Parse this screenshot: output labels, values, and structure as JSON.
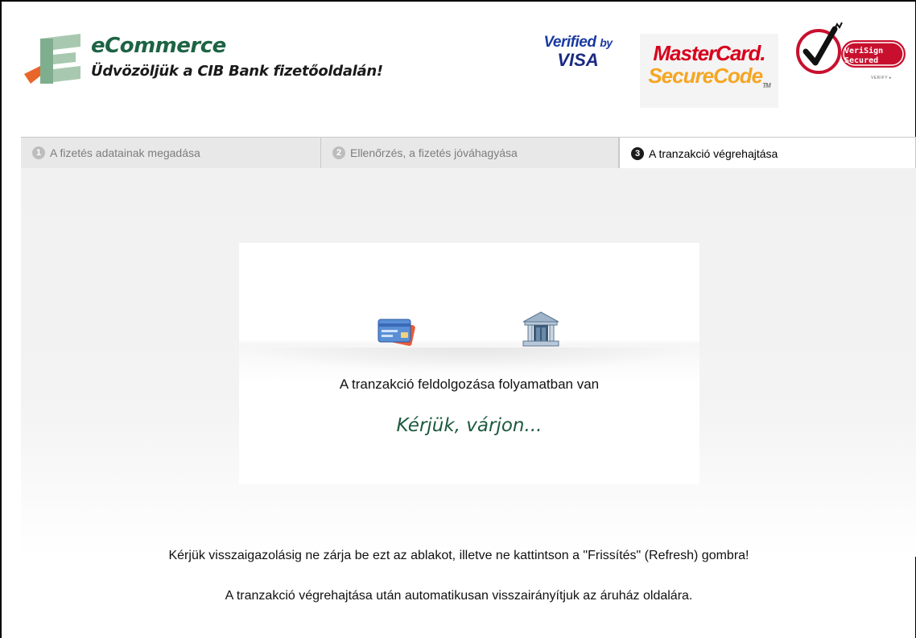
{
  "header": {
    "brand_title": "eCommerce",
    "brand_subtitle": "Üdvözöljük a CIB Bank fizetőoldalán!",
    "visa_badge": {
      "line1_main": "Verified",
      "line1_small": "by",
      "line2": "VISA"
    },
    "mastercard_badge": {
      "line1": "MasterCard.",
      "line2": "SecureCode",
      "tm": "TM"
    },
    "verisign_badge": {
      "line1": "VeriSign",
      "line2": "Secured",
      "verify": "VERIFY ▸"
    }
  },
  "tabs": [
    {
      "number": "1",
      "label": "A fizetés adatainak megadása",
      "active": false
    },
    {
      "number": "2",
      "label": "Ellenőrzés, a fizetés jóváhagyása",
      "active": false
    },
    {
      "number": "3",
      "label": "A tranzakció végrehajtása",
      "active": true
    }
  ],
  "panel": {
    "icons": [
      "credit-card-icon",
      "bank-icon"
    ],
    "processing_text": "A tranzakció feldolgozása folyamatban van",
    "wait_text": "Kérjük, várjon..."
  },
  "notices": {
    "line1": "Kérjük visszaigazolásig ne zárja be ezt az ablakot, illetve ne kattintson a \"Frissítés\" (Refresh) gombra!",
    "line2": "A tranzakció végrehajtása után automatikusan visszairányítjuk az áruház oldalára."
  },
  "colors": {
    "brand_green": "#1d6344",
    "logo_orange": "#e8662a",
    "visa_blue": "#1a3aa0",
    "mastercard_red": "#d6001c",
    "mastercard_orange": "#f5a623",
    "verisign_red": "#c8102e"
  }
}
